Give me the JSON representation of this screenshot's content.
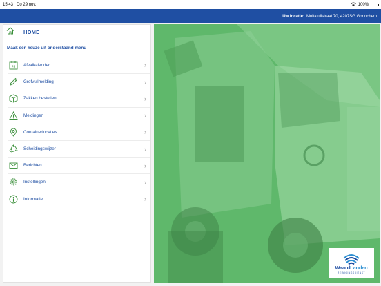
{
  "status_bar": {
    "time": "15:43",
    "date": "Do 29 nov.",
    "battery": "100%"
  },
  "app_bar": {
    "location_label": "Uw locatie:",
    "location_value": "Multatulistraat 70, 4207SG Gorinchem"
  },
  "panel": {
    "title": "HOME",
    "intro": "Maak een keuze uit onderstaand menu",
    "items": [
      {
        "label": "Afvalkalender",
        "icon": "calendar-icon"
      },
      {
        "label": "Grofvuilmelding",
        "icon": "pencil-icon"
      },
      {
        "label": "Zakken bestellen",
        "icon": "box-icon"
      },
      {
        "label": "Meldingen",
        "icon": "warning-icon"
      },
      {
        "label": "Containerlocaties",
        "icon": "location-pin-icon"
      },
      {
        "label": "Scheidingswijzer",
        "icon": "recycle-icon"
      },
      {
        "label": "Berichten",
        "icon": "envelope-icon"
      },
      {
        "label": "Instellingen",
        "icon": "gear-icon"
      },
      {
        "label": "Informatie",
        "icon": "info-icon"
      }
    ]
  },
  "logo": {
    "name_part1": "Waard",
    "name_part2": "Landen",
    "tagline": "REINIGINGSDIENST"
  },
  "colors": {
    "brand_blue": "#1f4fa3",
    "icon_green": "#3a8f3a",
    "hero_green": "#5fb86b"
  }
}
